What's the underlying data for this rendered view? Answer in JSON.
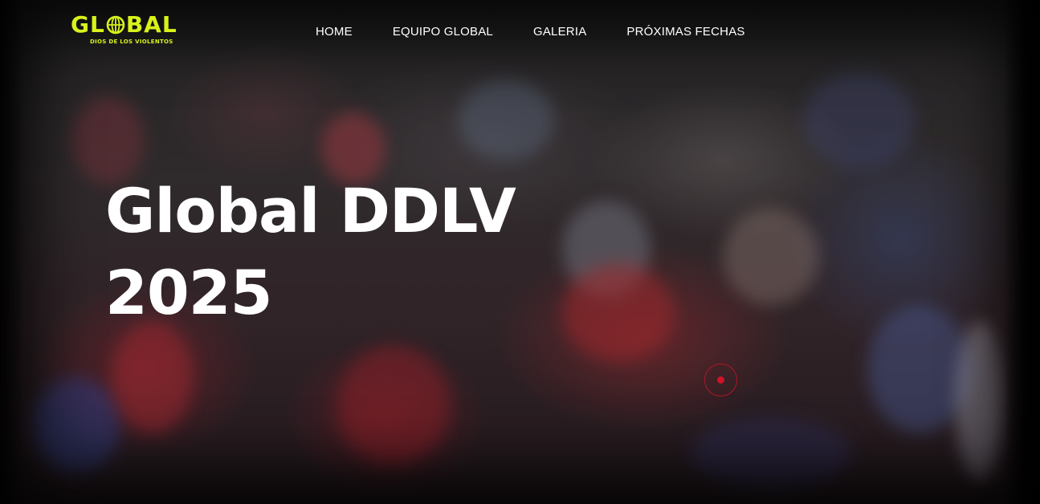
{
  "brand": {
    "name_left": "GL",
    "name_right": "BAL",
    "tagline": "DIOS DE LOS VIOLENTOS",
    "accent_color": "#d9f21a",
    "logo_icon": "globe-icon"
  },
  "nav": {
    "items": [
      {
        "label": "HOME"
      },
      {
        "label": "EQUIPO GLOBAL"
      },
      {
        "label": "GALERIA"
      },
      {
        "label": "PRÓXIMAS FECHAS"
      }
    ]
  },
  "hero": {
    "title_line1": "Global DDLV",
    "title_line2": "2025",
    "background": "crowd-worship-photo",
    "indicator_color": "#d01428"
  }
}
